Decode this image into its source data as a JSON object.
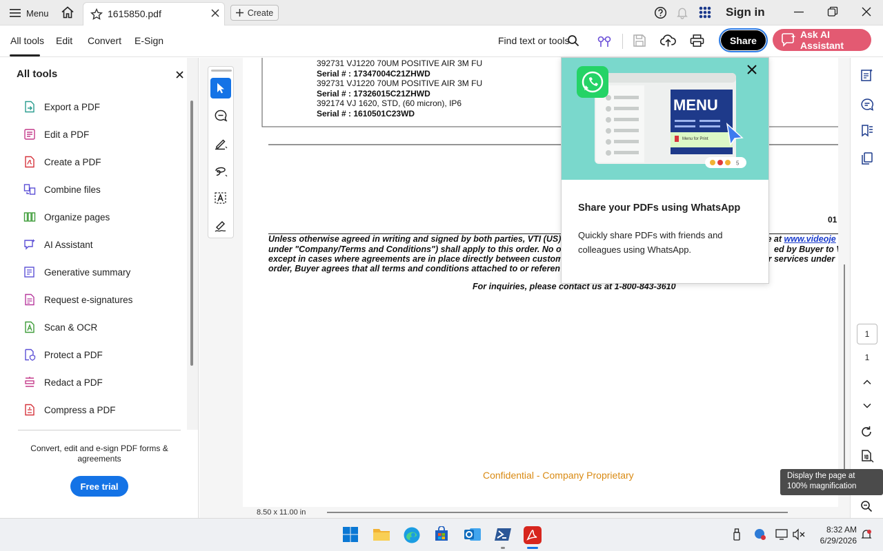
{
  "topbar": {
    "menu_label": "Menu",
    "tab_title": "1615850.pdf",
    "create_label": "Create",
    "signin_label": "Sign in"
  },
  "toolbar": {
    "tabs": [
      "All tools",
      "Edit",
      "Convert",
      "E-Sign"
    ],
    "find_label": "Find text or tools",
    "share_label": "Share",
    "ai_label": "Ask AI Assistant"
  },
  "sidebar": {
    "title": "All tools",
    "items": [
      {
        "label": "Export a PDF",
        "icon": "export-pdf-icon"
      },
      {
        "label": "Edit a PDF",
        "icon": "edit-pdf-icon"
      },
      {
        "label": "Create a PDF",
        "icon": "create-pdf-icon"
      },
      {
        "label": "Combine files",
        "icon": "combine-files-icon"
      },
      {
        "label": "Organize pages",
        "icon": "organize-pages-icon"
      },
      {
        "label": "AI Assistant",
        "icon": "ai-assistant-icon"
      },
      {
        "label": "Generative summary",
        "icon": "generative-summary-icon"
      },
      {
        "label": "Request e-signatures",
        "icon": "request-esignatures-icon"
      },
      {
        "label": "Scan & OCR",
        "icon": "scan-ocr-icon"
      },
      {
        "label": "Protect a PDF",
        "icon": "protect-pdf-icon"
      },
      {
        "label": "Redact a PDF",
        "icon": "redact-pdf-icon"
      },
      {
        "label": "Compress a PDF",
        "icon": "compress-pdf-icon"
      }
    ],
    "footer_text": "Convert, edit and e-sign PDF forms & agreements",
    "free_trial_label": "Free trial"
  },
  "document": {
    "lines": [
      {
        "left": "392731 VJ1220 70UM POSITIVE AIR 3M FU",
        "bold": false
      },
      {
        "left": "Serial # :  17347004C21ZHWD",
        "bold": true
      },
      {
        "left": "392731 VJ1220 70UM POSITIVE AIR 3M FU",
        "bold": false
      },
      {
        "left": "Serial # :  17326015C21ZHWD",
        "bold": true
      },
      {
        "left": "392174 VJ 1620, STD, (60 micron), IP6",
        "bold": false
      },
      {
        "left": "Serial # :  1610501C23WD",
        "bold": true
      }
    ],
    "page_marker": "01",
    "terms": [
      {
        "left": "Unless otherwise agreed in writing and signed by both parties, VTI (US)",
        "right": "le at ",
        "link": "www.videoje"
      },
      {
        "left": "under \"Company/Terms and Conditions\") shall apply to this order. No o",
        "right": "ed by Buyer to V",
        "link": ""
      },
      {
        "left": "except in cases where agreements are in place directly between custom",
        "right": "or services under",
        "link": ""
      },
      {
        "left": "order, Buyer agrees that all terms and conditions attached to or referen",
        "right": "",
        "link": ""
      }
    ],
    "inquiries": "For inquiries, please contact us at 1-800-843-3610",
    "confidential": "Confidential - Company Proprietary",
    "page_size": "8.50 x 11.00 in"
  },
  "popup": {
    "title": "Share your PDFs using WhatsApp",
    "body": "Quickly share PDFs with friends and colleagues using WhatsApp.",
    "hero_menu_title": "MENU",
    "hero_reactions": "5",
    "hero_file_name": "Menu for Print"
  },
  "navigation": {
    "current_page": "1",
    "total_pages": "1"
  },
  "tooltip": "Display the page at 100% magnification",
  "clock": {
    "time": "8:32 AM",
    "date": "6/29/2026"
  },
  "colors": {
    "accent": "#1473e6",
    "ai_button": "#e35a72",
    "confidential": "#d98a13",
    "popup_hero": "#7ad8cc",
    "whatsapp": "#25d366"
  }
}
